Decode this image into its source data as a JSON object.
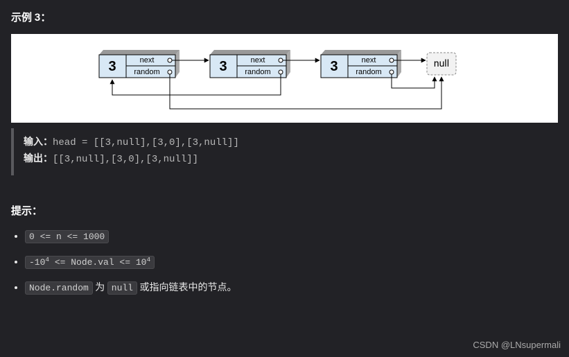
{
  "exampleTitle": "示例 3：",
  "io": {
    "inputLabel": "输入：",
    "inputValue": "head = [[3,null],[3,0],[3,null]]",
    "outputLabel": "输出：",
    "outputValue": "[[3,null],[3,0],[3,null]]"
  },
  "hintsTitle": "提示：",
  "hints": {
    "item0": "0 <= n <= 1000",
    "item1": {
      "pre": "-10",
      "supA": "4",
      "mid": " <= Node.val <= 10",
      "supB": "4"
    },
    "item2": {
      "code1": "Node.random",
      "txt1": " 为 ",
      "code2": "null",
      "txt2": " 或指向链表中的节点。"
    }
  },
  "diagram": {
    "nodes": [
      {
        "val": "3",
        "next": "next",
        "random": "random"
      },
      {
        "val": "3",
        "next": "next",
        "random": "random"
      },
      {
        "val": "3",
        "next": "next",
        "random": "random"
      }
    ],
    "null": "null"
  },
  "watermark": "CSDN @LNsupermali"
}
